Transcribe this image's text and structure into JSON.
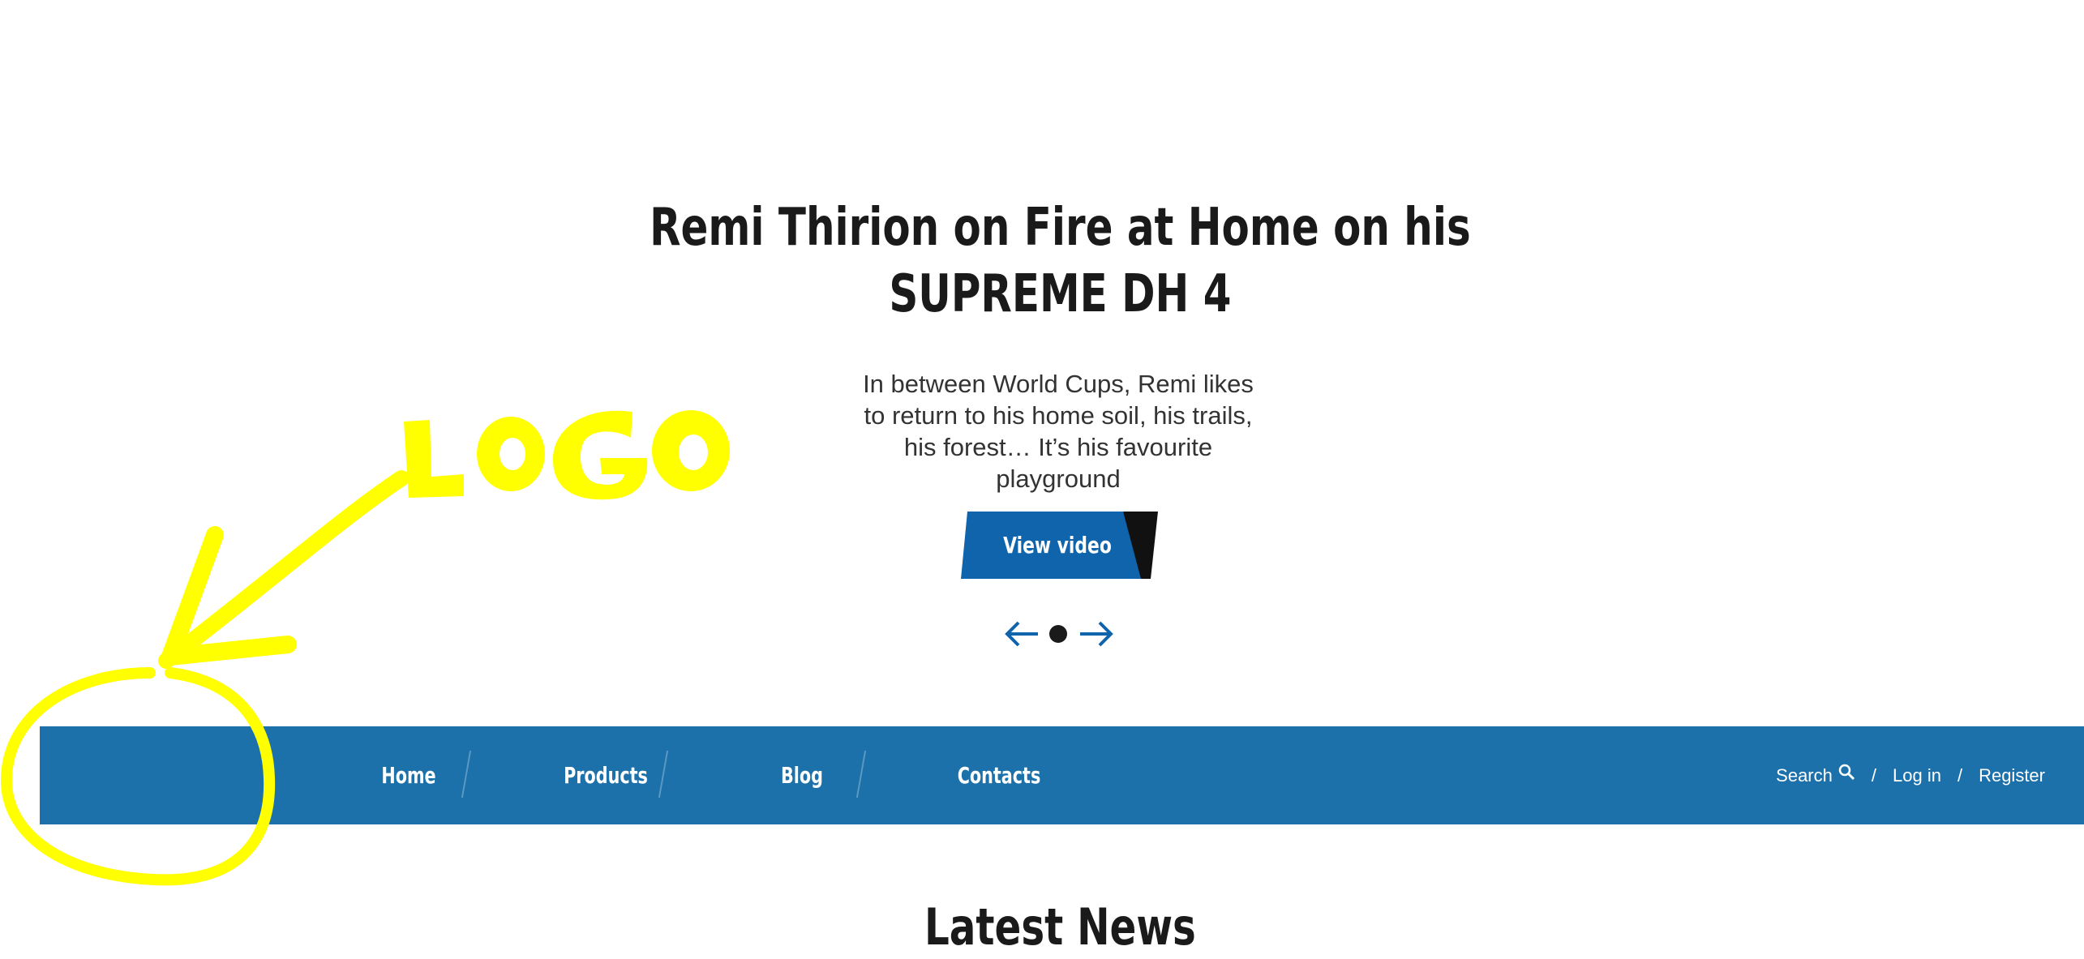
{
  "hero": {
    "title_line1": "Remi Thirion on Fire at Home on his",
    "title_line2": "SUPREME DH 4",
    "description": "In between World Cups, Remi likes to return to his home soil, his trails, his forest… It’s his favourite playground",
    "button_label": "View video"
  },
  "slider": {
    "prev_icon": "arrow-left-icon",
    "next_icon": "arrow-right-icon",
    "dots": 1
  },
  "nav": {
    "items": [
      {
        "label": "Home"
      },
      {
        "label": "Products"
      },
      {
        "label": "Blog"
      },
      {
        "label": "Contacts"
      }
    ],
    "search_label": "Search",
    "login_label": "Log in",
    "register_label": "Register",
    "separator": "/"
  },
  "news": {
    "title": "Latest News"
  },
  "annotation": {
    "text": "LOGO",
    "color": "#ffff00"
  },
  "colors": {
    "brand_blue": "#1c71ab",
    "button_blue": "#0f64ac",
    "dark": "#1a1a1a"
  }
}
